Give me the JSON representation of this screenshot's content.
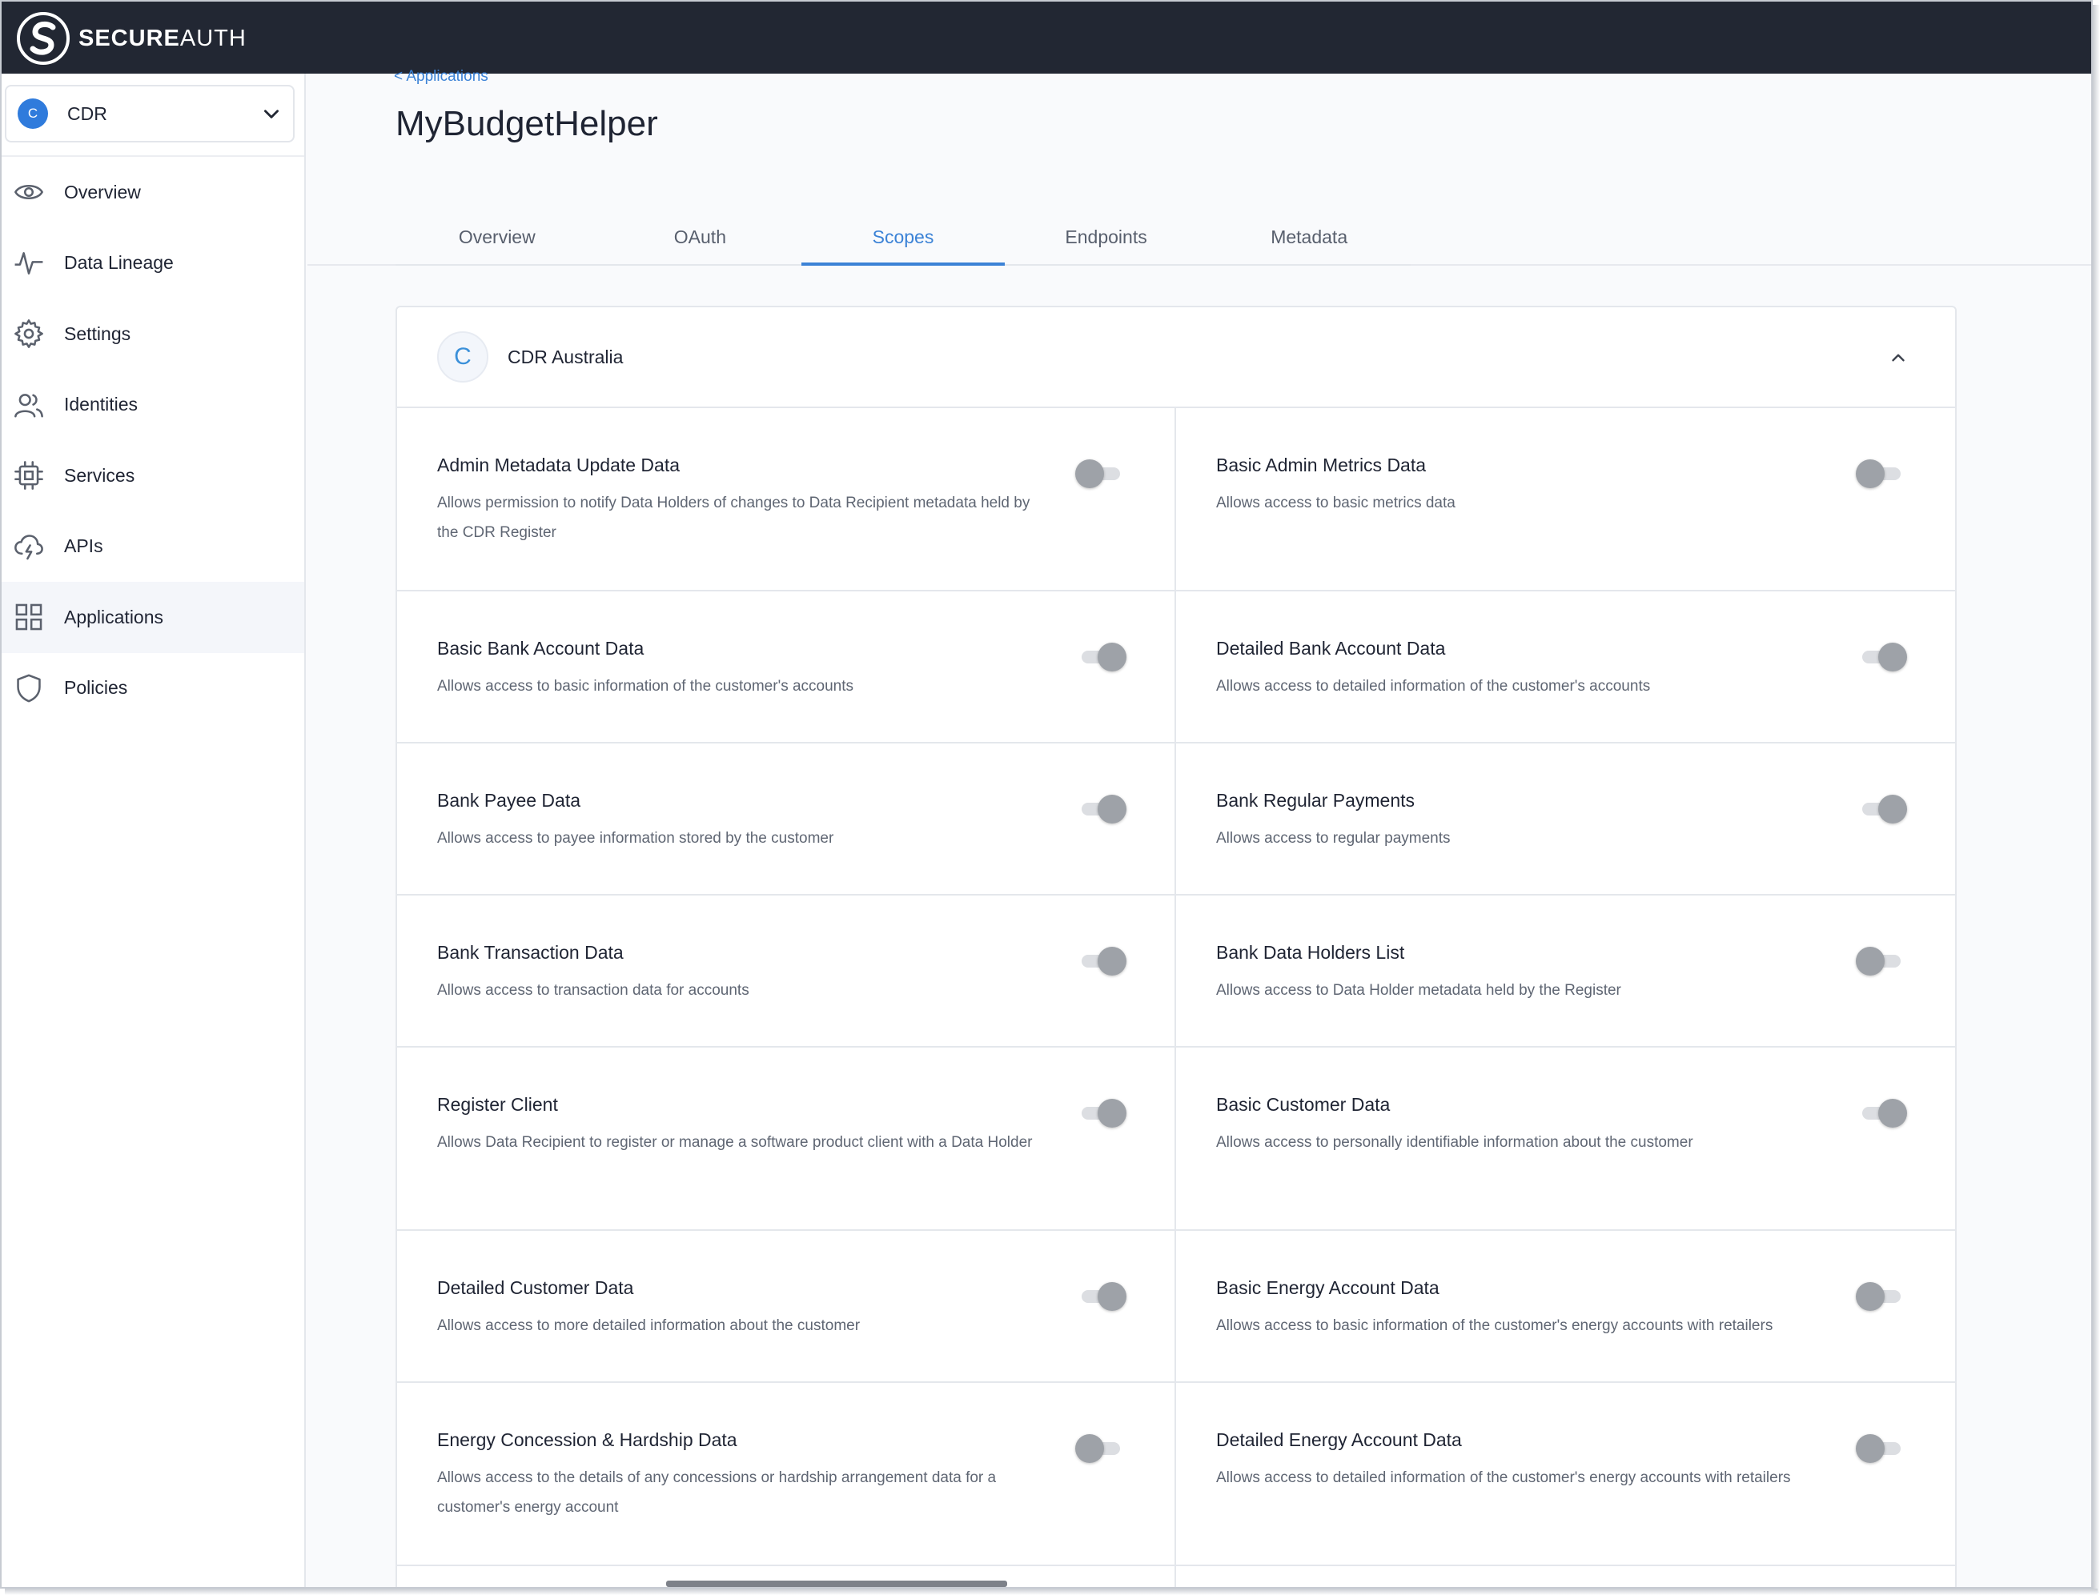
{
  "brand": {
    "strong": "SECURE",
    "light": "AUTH"
  },
  "tenant": {
    "initial": "C",
    "name": "CDR"
  },
  "nav": [
    {
      "label": "Overview",
      "icon": "eye-icon"
    },
    {
      "label": "Data Lineage",
      "icon": "activity-icon"
    },
    {
      "label": "Settings",
      "icon": "gear-icon"
    },
    {
      "label": "Identities",
      "icon": "users-icon"
    },
    {
      "label": "Services",
      "icon": "chip-icon"
    },
    {
      "label": "APIs",
      "icon": "cloud-bolt-icon"
    },
    {
      "label": "Applications",
      "icon": "grid-icon",
      "active": true
    },
    {
      "label": "Policies",
      "icon": "shield-icon"
    }
  ],
  "breadcrumb": "< Applications",
  "page_title": "MyBudgetHelper",
  "tabs": [
    {
      "label": "Overview"
    },
    {
      "label": "OAuth"
    },
    {
      "label": "Scopes",
      "active": true
    },
    {
      "label": "Endpoints"
    },
    {
      "label": "Metadata"
    }
  ],
  "card": {
    "initial": "C",
    "title": "CDR Australia"
  },
  "scopes": [
    {
      "name": "Admin Metadata Update Data",
      "desc": "Allows permission to notify Data Holders of changes to Data Recipient metadata held by the CDR Register",
      "enabled": false
    },
    {
      "name": "Basic Admin Metrics Data",
      "desc": "Allows access to basic metrics data",
      "enabled": false
    },
    {
      "name": "Basic Bank Account Data",
      "desc": "Allows access to basic information of the customer's accounts",
      "enabled": true
    },
    {
      "name": "Detailed Bank Account Data",
      "desc": "Allows access to detailed information of the customer's accounts",
      "enabled": true
    },
    {
      "name": "Bank Payee Data",
      "desc": "Allows access to payee information stored by the customer",
      "enabled": true
    },
    {
      "name": "Bank Regular Payments",
      "desc": "Allows access to regular payments",
      "enabled": true
    },
    {
      "name": "Bank Transaction Data",
      "desc": "Allows access to transaction data for accounts",
      "enabled": true
    },
    {
      "name": "Bank Data Holders List",
      "desc": "Allows access to Data Holder metadata held by the Register",
      "enabled": false
    },
    {
      "name": "Register Client",
      "desc": "Allows Data Recipient to register or manage a software product client with a Data Holder",
      "enabled": true
    },
    {
      "name": "Basic Customer Data",
      "desc": "Allows access to personally identifiable information about the customer",
      "enabled": true
    },
    {
      "name": "Detailed Customer Data",
      "desc": "Allows access to more detailed information about the customer",
      "enabled": true
    },
    {
      "name": "Basic Energy Account Data",
      "desc": "Allows access to basic information of the customer's energy accounts with retailers",
      "enabled": false
    },
    {
      "name": "Energy Concession & Hardship Data",
      "desc": "Allows access to the details of any concessions or hardship arrangement data for a customer's energy account",
      "enabled": false
    },
    {
      "name": "Detailed Energy Account Data",
      "desc": "Allows access to detailed information of the customer's energy accounts with retailers",
      "enabled": false
    }
  ]
}
